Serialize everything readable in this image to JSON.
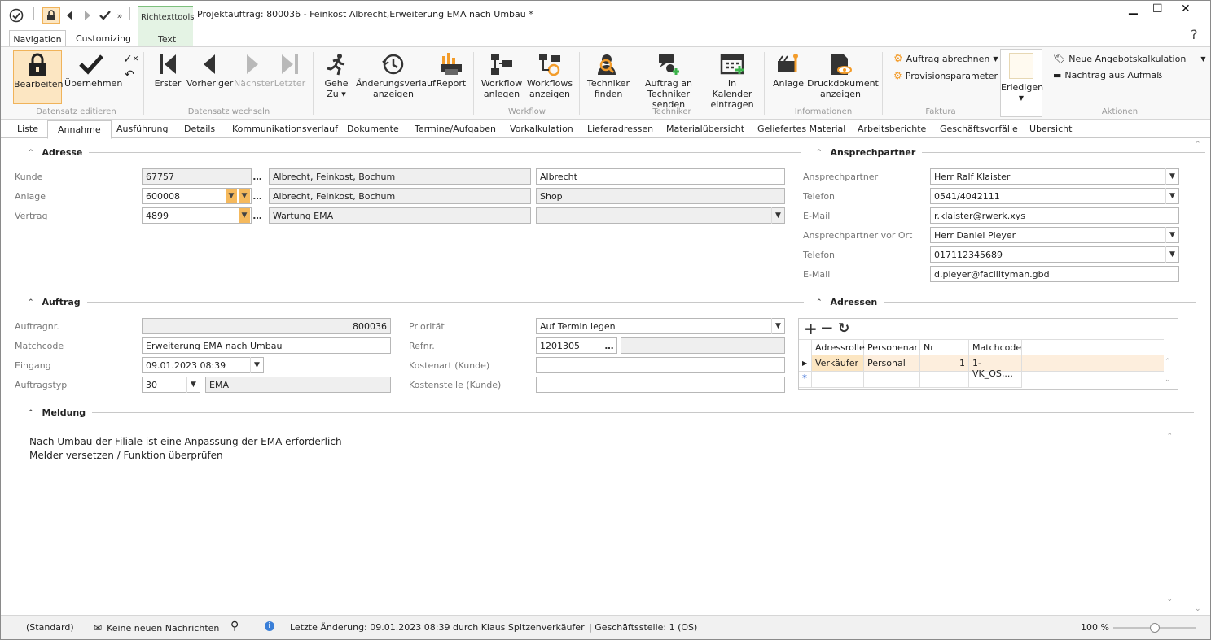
{
  "window": {
    "title": "Projektauftrag: 800036 - Feinkost Albrecht,Erweiterung EMA nach Umbau *",
    "context_tab_label": "Richtexttools"
  },
  "quick_access": [
    "check-circle-icon",
    "lock-icon",
    "prev-icon",
    "next-icon",
    "check-icon",
    "more-icon"
  ],
  "window_controls": {
    "minimize": "▁",
    "maximize": "☐",
    "close": "✕",
    "help": "?"
  },
  "ribbon_tabs": [
    "Navigation",
    "Customizing",
    "Text"
  ],
  "ribbon": {
    "groups": [
      {
        "label": "Datensatz editieren"
      },
      {
        "label": "Datensatz wechseln"
      },
      {
        "label": ""
      },
      {
        "label": "Workflow"
      },
      {
        "label": "Techniker"
      },
      {
        "label": "Informationen"
      },
      {
        "label": "Faktura"
      },
      {
        "label": "Aktionen"
      }
    ],
    "buttons": {
      "bearbeiten": "Bearbeiten",
      "uebernehmen": "Übernehmen",
      "erster": "Erster",
      "vorheriger": "Vorheriger",
      "naechster": "Nächster",
      "letzter": "Letzter",
      "gehe_zu_1": "Gehe",
      "gehe_zu_2": "Zu ▾",
      "aenderung_1": "Änderungsverlauf",
      "aenderung_2": "anzeigen",
      "report": "Report",
      "wf_anlegen_1": "Workflow",
      "wf_anlegen_2": "anlegen",
      "wf_anzeigen_1": "Workflows",
      "wf_anzeigen_2": "anzeigen",
      "tech_finden_1": "Techniker",
      "tech_finden_2": "finden",
      "auftrag_senden_1": "Auftrag an",
      "auftrag_senden_2": "Techniker senden",
      "kalender_1": "In Kalender",
      "kalender_2": "eintragen",
      "anlage": "Anlage",
      "druck_1": "Druckdokument",
      "druck_2": "anzeigen",
      "auftrag_abrechnen": "Auftrag abrechnen",
      "provisionsparameter": "Provisionsparameter",
      "erledigen": "Erledigen",
      "neue_angebot": "Neue Angebotskalkulation",
      "nachtrag": "Nachtrag aus Aufmaß"
    }
  },
  "nav_tabs": [
    "Liste",
    "Annahme",
    "Ausführung",
    "Details",
    "Kommunikationsverlauf",
    "Dokumente",
    "Termine/Aufgaben",
    "Vorkalkulation",
    "Lieferadressen",
    "Materialübersicht",
    "Geliefertes Material",
    "Arbeitsberichte",
    "Geschäftsvorfälle",
    "Übersicht"
  ],
  "adresse": {
    "title": "Adresse",
    "kunde_label": "Kunde",
    "kunde_nr": "67757",
    "kunde_name": "Albrecht, Feinkost, Bochum",
    "kunde_extra": "Albrecht",
    "anlage_label": "Anlage",
    "anlage_nr": "600008",
    "anlage_name": "Albrecht, Feinkost, Bochum",
    "anlage_extra": "Shop",
    "vertrag_label": "Vertrag",
    "vertrag_nr": "4899",
    "vertrag_name": "Wartung EMA",
    "vertrag_extra": ""
  },
  "ansprechpartner": {
    "title": "Ansprechpartner",
    "ap_label": "Ansprechpartner",
    "ap_value": "Herr Ralf Klaister",
    "tel_label": "Telefon",
    "tel_value": "0541/4042111",
    "mail_label": "E-Mail",
    "mail_value": "r.klaister@rwerk.xys",
    "ap_ort_label": "Ansprechpartner vor Ort",
    "ap_ort_value": "Herr Daniel Pleyer",
    "tel2_label": "Telefon",
    "tel2_value": "017112345689",
    "mail2_label": "E-Mail",
    "mail2_value": "d.pleyer@facilityman.gbd"
  },
  "auftrag": {
    "title": "Auftrag",
    "auftragnr_label": "Auftragnr.",
    "auftragnr": "800036",
    "matchcode_label": "Matchcode",
    "matchcode": "Erweiterung EMA nach Umbau",
    "eingang_label": "Eingang",
    "eingang": "09.01.2023 08:39",
    "auftragstyp_label": "Auftragstyp",
    "auftragstyp_nr": "30",
    "auftragstyp_name": "EMA",
    "prioritaet_label": "Priorität",
    "prioritaet": "Auf Termin legen",
    "refnr_label": "Refnr.",
    "refnr": "1201305",
    "refnr_extra": "",
    "kostenart_label": "Kostenart (Kunde)",
    "kostenart": "",
    "kostenstelle_label": "Kostenstelle (Kunde)",
    "kostenstelle": ""
  },
  "adressen": {
    "title": "Adressen",
    "columns": [
      "Adressrolle",
      "Personenart",
      "Nr",
      "Matchcode"
    ],
    "rows": [
      [
        "Verkäufer",
        "Personal",
        "1",
        "1-VK_OS,..."
      ]
    ]
  },
  "meldung": {
    "title": "Meldung",
    "lines": [
      "Nach Umbau der Filiale ist eine Anpassung der EMA erforderlich",
      "Melder versetzen / Funktion überprüfen"
    ]
  },
  "status": {
    "standard": "(Standard)",
    "nachrichten": "Keine neuen Nachrichten",
    "letzte_aenderung": "Letzte Änderung: 09.01.2023 08:39 durch Klaus Spitzenverkäufer",
    "geschaeftsstelle": "| Geschäftsstelle:  1 (OS)",
    "zoom": "100 %",
    "zoom_level": 0.5
  },
  "colors": {
    "accent": "#f5b95d",
    "selected_bg": "#fce6c2",
    "context_tab": "#e4f3e4"
  }
}
